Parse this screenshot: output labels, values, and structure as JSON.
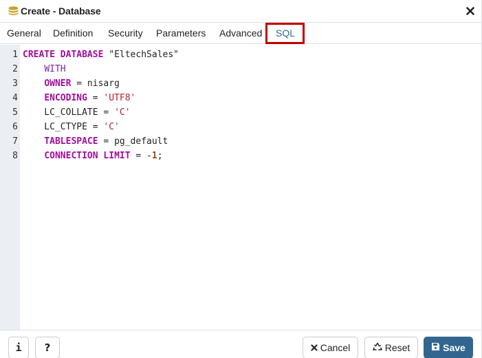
{
  "dialog": {
    "title": "Create - Database",
    "title_icon": "database-icon",
    "close_icon": "close-icon"
  },
  "tabs": [
    {
      "label": "General",
      "active": false
    },
    {
      "label": "Definition",
      "active": false
    },
    {
      "label": "Security",
      "active": false
    },
    {
      "label": "Parameters",
      "active": false
    },
    {
      "label": "Advanced",
      "active": false
    },
    {
      "label": "SQL",
      "active": true
    }
  ],
  "editor": {
    "line_numbers": [
      "1",
      "2",
      "3",
      "4",
      "5",
      "6",
      "7",
      "8"
    ],
    "lines": [
      [
        {
          "t": "CREATE",
          "c": "kw"
        },
        {
          "t": " ",
          "c": "plain"
        },
        {
          "t": "DATABASE",
          "c": "kw"
        },
        {
          "t": " \"EltechSales\"",
          "c": "plain"
        }
      ],
      [
        {
          "t": "    ",
          "c": "plain"
        },
        {
          "t": "WITH",
          "c": "kw2"
        }
      ],
      [
        {
          "t": "    ",
          "c": "plain"
        },
        {
          "t": "OWNER",
          "c": "kw"
        },
        {
          "t": " = nisarg",
          "c": "plain"
        }
      ],
      [
        {
          "t": "    ",
          "c": "plain"
        },
        {
          "t": "ENCODING",
          "c": "kw"
        },
        {
          "t": " = ",
          "c": "plain"
        },
        {
          "t": "'UTF8'",
          "c": "str"
        }
      ],
      [
        {
          "t": "    LC_COLLATE = ",
          "c": "plain"
        },
        {
          "t": "'C'",
          "c": "str"
        }
      ],
      [
        {
          "t": "    LC_CTYPE = ",
          "c": "plain"
        },
        {
          "t": "'C'",
          "c": "str"
        }
      ],
      [
        {
          "t": "    ",
          "c": "plain"
        },
        {
          "t": "TABLESPACE",
          "c": "kw"
        },
        {
          "t": " = pg_default",
          "c": "plain"
        }
      ],
      [
        {
          "t": "    ",
          "c": "plain"
        },
        {
          "t": "CONNECTION",
          "c": "kw"
        },
        {
          "t": " ",
          "c": "plain"
        },
        {
          "t": "LIMIT",
          "c": "kw"
        },
        {
          "t": " = -",
          "c": "plain"
        },
        {
          "t": "1",
          "c": "num"
        },
        {
          "t": ";",
          "c": "plain"
        }
      ]
    ]
  },
  "footer": {
    "info_label": "i",
    "help_label": "?",
    "cancel_label": "Cancel",
    "reset_label": "Reset",
    "save_label": "Save"
  },
  "colors": {
    "primary": "#326690",
    "highlight": "#c00000",
    "keyword": "#a20e9b",
    "string": "#b5202e"
  }
}
